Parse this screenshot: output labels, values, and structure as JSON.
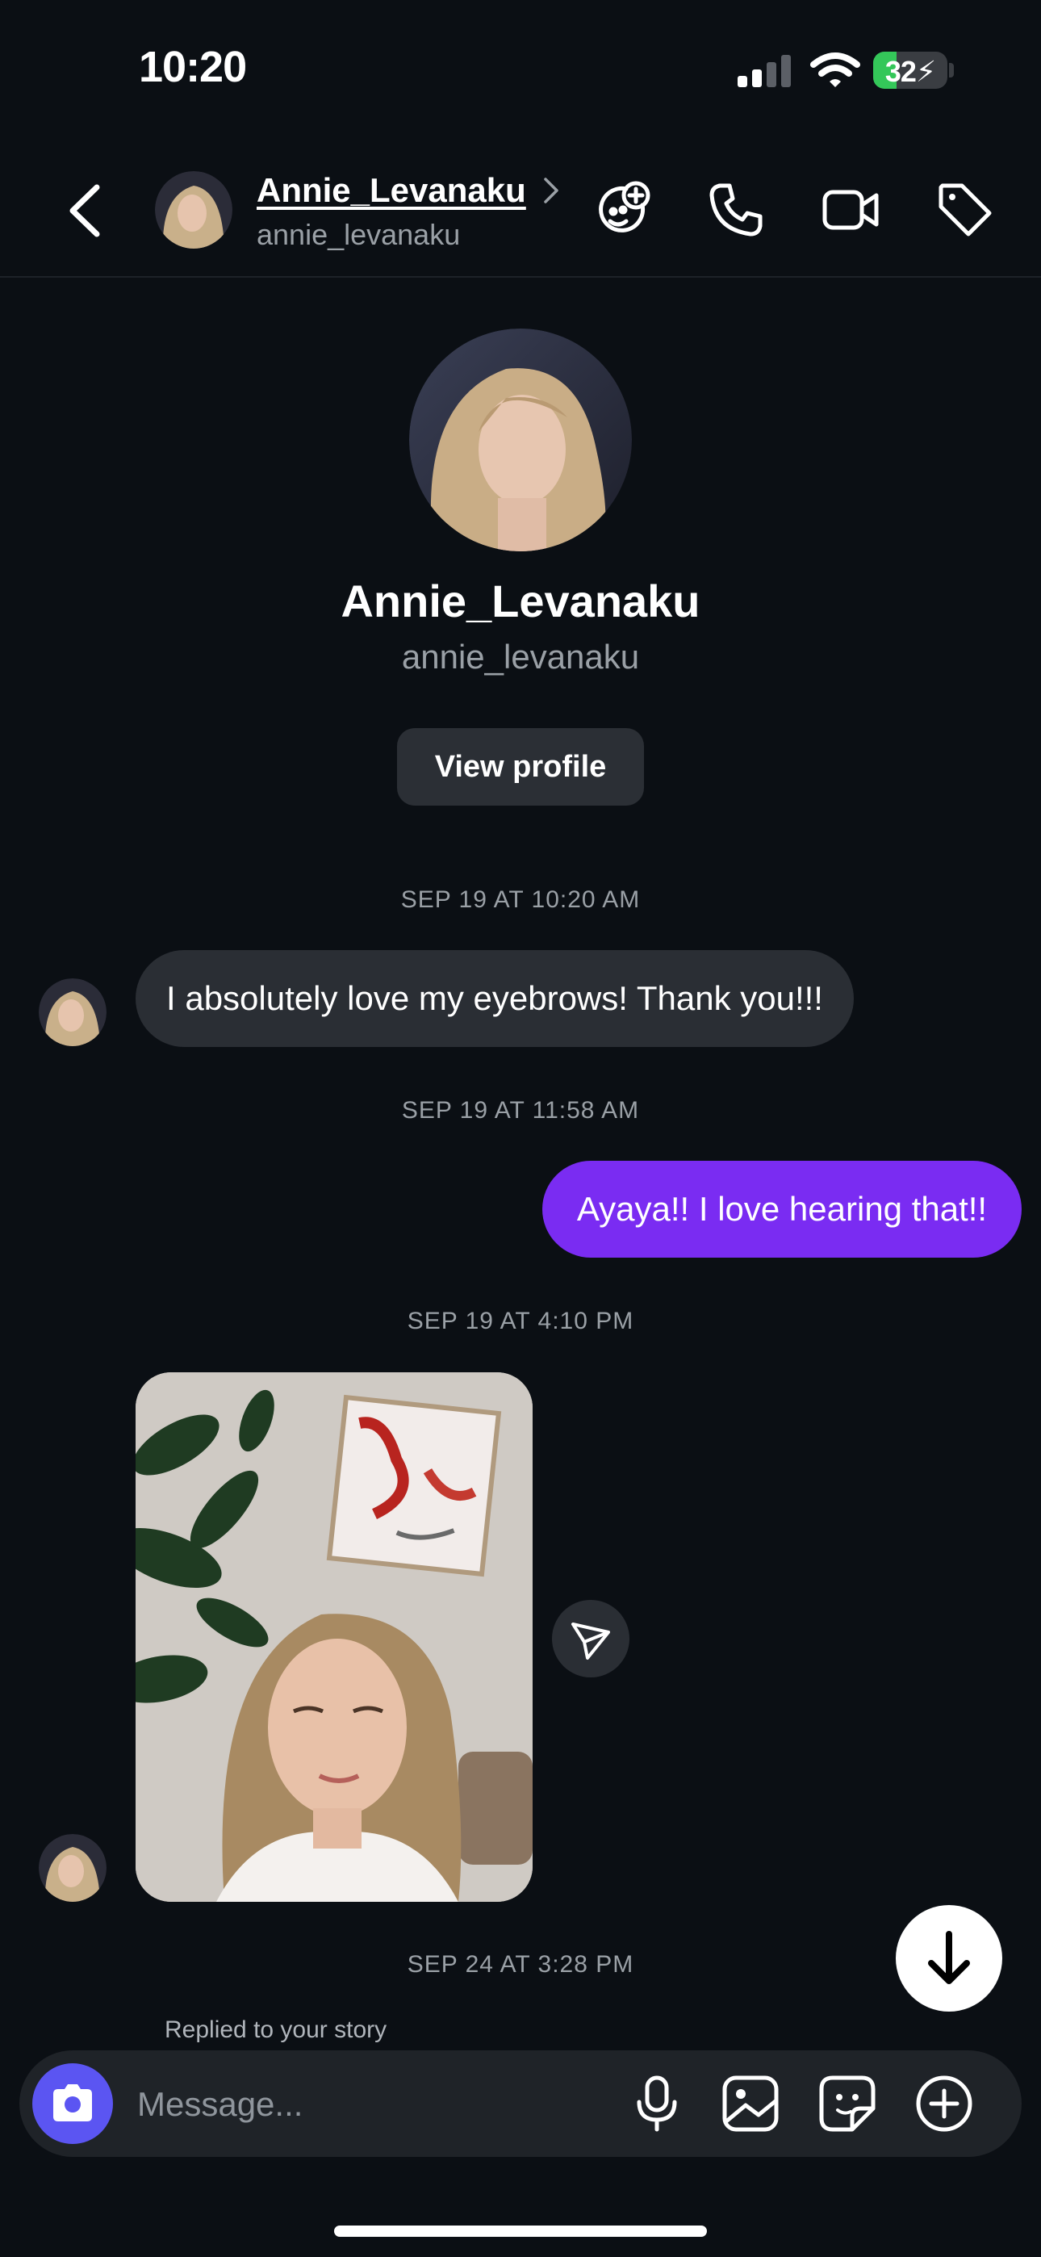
{
  "status_bar": {
    "time": "10:20",
    "battery_percent": "32",
    "battery_fill_fraction": 0.32,
    "battery_color": "#34c759",
    "icons": [
      "signal-icon",
      "wifi-icon",
      "battery-charging-icon"
    ]
  },
  "header": {
    "display_name": "Annie_Levanaku",
    "username": "annie_levanaku",
    "icons": [
      "back-chevron-icon",
      "add-effect-icon",
      "phone-icon",
      "video-icon",
      "tag-icon"
    ]
  },
  "profile": {
    "display_name": "Annie_Levanaku",
    "username": "annie_levanaku",
    "view_profile_label": "View profile"
  },
  "messages": [
    {
      "timestamp": "SEP 19 AT 10:20 AM",
      "direction": "incoming",
      "text": "I absolutely love my eyebrows! Thank you!!!"
    },
    {
      "timestamp": "SEP 19 AT 11:58 AM",
      "direction": "outgoing",
      "text": "Ayaya!! I love hearing that!!"
    },
    {
      "timestamp": "SEP 19 AT 4:10 PM",
      "direction": "incoming",
      "type": "photo"
    },
    {
      "timestamp": "SEP 24 AT 3:28 PM",
      "direction": "incoming",
      "note": "Replied to your story"
    }
  ],
  "composer": {
    "placeholder": "Message...",
    "icons": [
      "camera-icon",
      "microphone-icon",
      "gallery-icon",
      "sticker-icon",
      "add-icon"
    ]
  },
  "colors": {
    "background": "#0b0f14",
    "outgoing_bubble": "#7a2cf2",
    "incoming_bubble": "#2a2e34",
    "camera_button": "#5b55f2"
  }
}
